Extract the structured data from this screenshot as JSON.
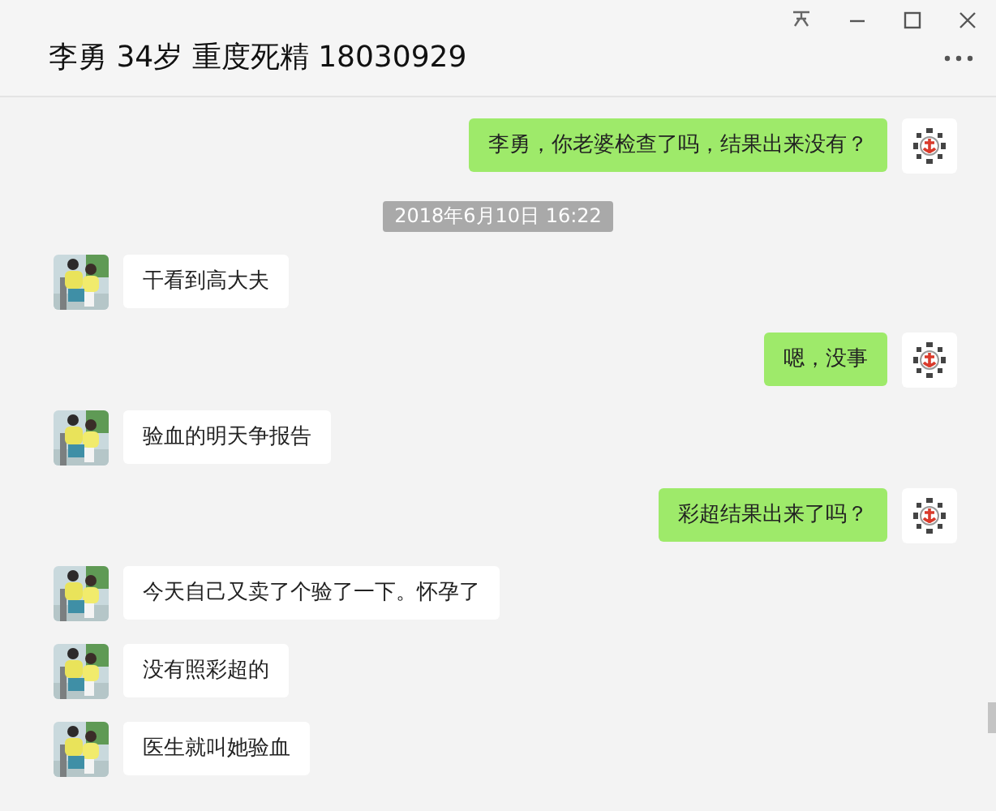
{
  "window": {
    "title": "李勇 34岁 重度死精 18030929"
  },
  "messages": [
    {
      "kind": "outgoing",
      "text": "李勇，你老婆检查了吗，结果出来没有？"
    },
    {
      "kind": "time",
      "text": "2018年6月10日 16:22"
    },
    {
      "kind": "incoming",
      "text": "干看到高大夫"
    },
    {
      "kind": "outgoing",
      "text": "嗯，没事"
    },
    {
      "kind": "incoming",
      "text": "验血的明天争报告"
    },
    {
      "kind": "outgoing",
      "text": "彩超结果出来了吗？"
    },
    {
      "kind": "incoming",
      "text": "今天自己又卖了个验了一下。怀孕了"
    },
    {
      "kind": "incoming",
      "text": "没有照彩超的"
    },
    {
      "kind": "incoming",
      "text": "医生就叫她验血"
    }
  ]
}
